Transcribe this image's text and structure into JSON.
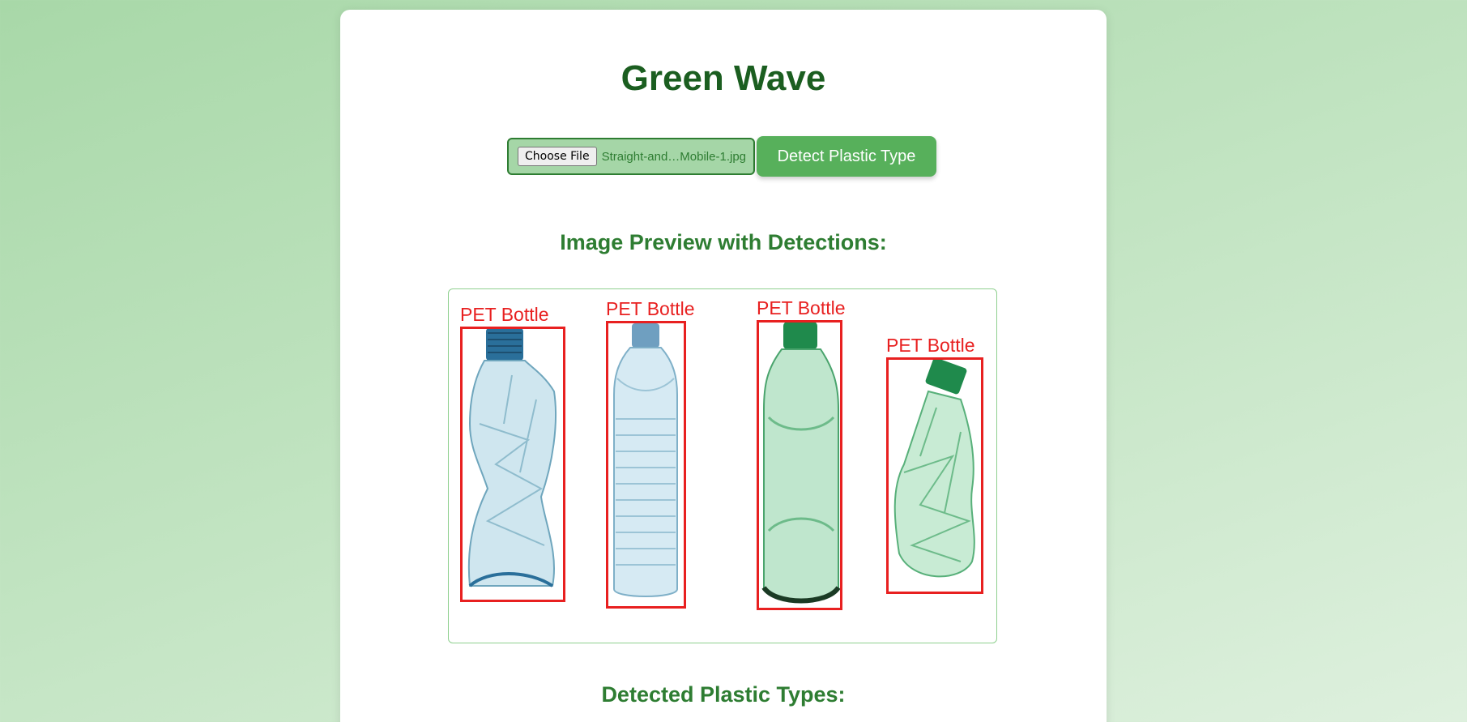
{
  "app": {
    "title": "Green Wave"
  },
  "upload": {
    "choose_button_label": "Choose File",
    "file_name": "Straight-and…Mobile-1.jpg",
    "detect_button_label": "Detect Plastic Type"
  },
  "preview": {
    "heading": "Image Preview with Detections:",
    "detections": [
      {
        "label": "PET Bottle"
      },
      {
        "label": "PET Bottle"
      },
      {
        "label": "PET Bottle"
      },
      {
        "label": "PET Bottle"
      }
    ]
  },
  "results": {
    "heading": "Detected Plastic Types:"
  },
  "colors": {
    "primary_green": "#1b5e20",
    "accent_green": "#57b05b",
    "detection_red": "#e82020"
  }
}
